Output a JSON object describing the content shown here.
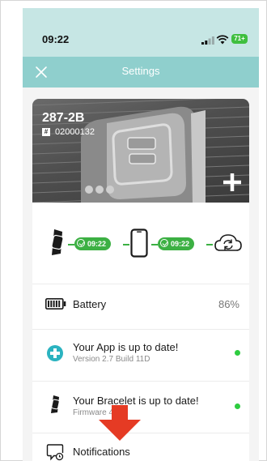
{
  "status_bar": {
    "time": "09:22",
    "battery_level": "71+",
    "icons": [
      "signal-icon",
      "wifi-icon",
      "battery-icon"
    ]
  },
  "header": {
    "title": "Settings",
    "close_icon": "close-icon"
  },
  "device": {
    "name": "287-2B",
    "serial": "02000132",
    "add_icon": "plus-icon"
  },
  "sync": {
    "bracelet_time": "09:22",
    "phone_time": "09:22",
    "icons": [
      "bracelet-icon",
      "phone-icon",
      "cloud-sync-icon"
    ]
  },
  "battery": {
    "label": "Battery",
    "value": "86%",
    "level": 0.86
  },
  "app_update": {
    "title": "Your App is up to date!",
    "subtitle": "Version 2.7 Build 11D"
  },
  "bracelet_update": {
    "title": "Your Bracelet is up to date!",
    "subtitle": "Firmware 4.12"
  },
  "notifications": {
    "label": "Notifications"
  },
  "colors": {
    "status_bg": "#c6e6e4",
    "header_bg": "#8fcfcd",
    "sync_green": "#3cb043",
    "app_icon": "#2bb3c0",
    "dot_green": "#2ecc40",
    "arrow_red": "#e53b24"
  }
}
